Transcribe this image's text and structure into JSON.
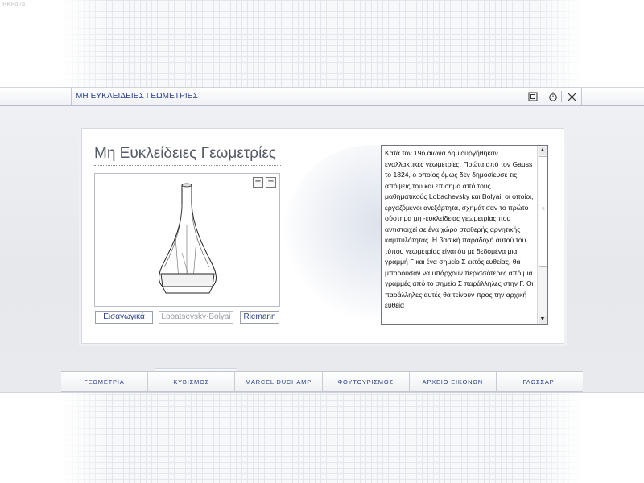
{
  "corner_id": "BK8424",
  "window": {
    "title": "ΜΗ ΕΥΚΛΕΙΔΕΙΕΣ ΓΕΩΜΕΤΡΙΕΣ",
    "controls": {
      "restore_icon": "restore-icon",
      "timer_icon": "stopwatch-icon",
      "close_icon": "close-icon"
    }
  },
  "content": {
    "heading": "Μη Ευκλείδειες Γεωμετρίες",
    "zoom": {
      "plus": "+",
      "minus": "−"
    },
    "buttons": [
      {
        "label": "Εισαγωγικά"
      },
      {
        "label": "Lobatsevsky-Bolyai"
      },
      {
        "label": "Riemann"
      }
    ],
    "text": "Κατά τον 19ο αιώνα δημιουργήθηκαν εναλλακτικές γεωμετρίες. Πρώτα από τον Gauss το 1824, ο οποίος όμως δεν δημοσίευσε τις απόψεις του και επίσημα από τους μαθηματικούς Lobachevsky και Bolyai, οι οποίοι, εργαζόμενοι ανεξάρτητα, σχημάτισαν το πρώτο σύστημα μη -ευκλείδειας γεωμετρίας που αντιστοιχεί σε ένα χώρο σταθερής αρνητικής καμπυλότητας. Η βασική παραδοχή αυτού του τύπου γεωμετρίας είναι ότι με δεδομένα μια γραμμή Γ και ένα σημείο Σ εκτός ευθείας, θα μπορούσαν να υπάρχουν περισσότερες από μια γραμμές από το σημείο Σ παράλληλες στην Γ. Οι παράλληλες αυτές θα τείνουν προς την αρχική ευθεία"
  },
  "nav": [
    {
      "label": "ΓΕΩΜΕΤΡΙΑ"
    },
    {
      "label": "ΚΥΒΙΣΜΟΣ"
    },
    {
      "label": "MARCEL DUCHAMP"
    },
    {
      "label": "ΦΟΥΤΟΥΡΙΣΜΟΣ"
    },
    {
      "label": "ΑΡΧΕΙΟ ΕΙΚΟΝΩΝ"
    },
    {
      "label": "ΓΛΩΣΣΑΡΙ"
    }
  ],
  "colors": {
    "accent": "#2a3f8a",
    "text": "#111111",
    "heading": "#555a66"
  }
}
